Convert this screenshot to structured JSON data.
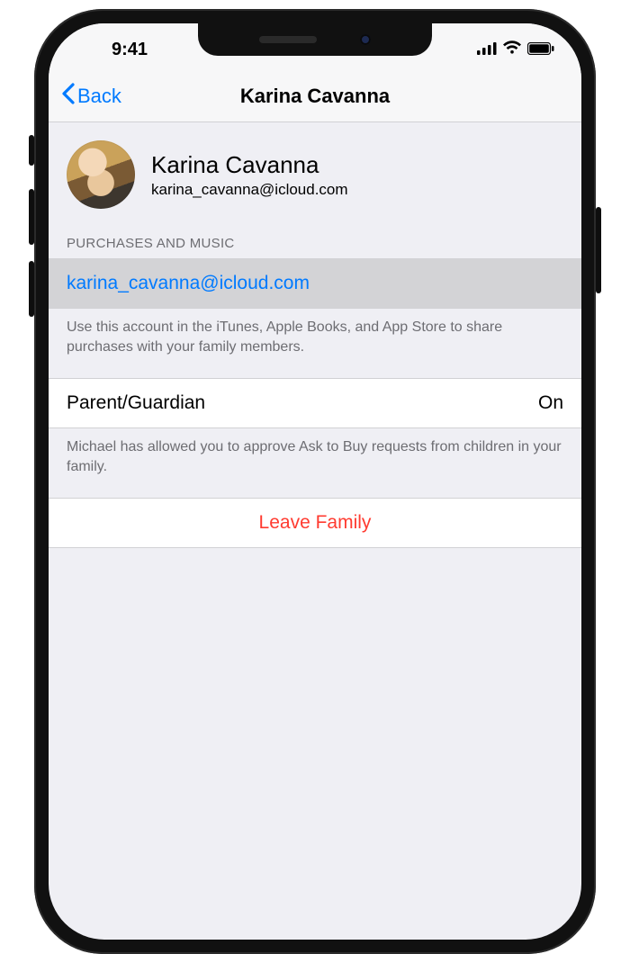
{
  "statusbar": {
    "time": "9:41"
  },
  "nav": {
    "back_label": "Back",
    "title": "Karina Cavanna"
  },
  "profile": {
    "name": "Karina Cavanna",
    "email": "karina_cavanna@icloud.com"
  },
  "purchases": {
    "section_title": "PURCHASES AND MUSIC",
    "account_email": "karina_cavanna@icloud.com",
    "note": "Use this account in the iTunes, Apple Books, and App Store to share purchases with your family members."
  },
  "guardian": {
    "label": "Parent/Guardian",
    "value": "On",
    "note": "Michael has allowed you to approve Ask to Buy requests from children in your family."
  },
  "leave": {
    "label": "Leave Family"
  }
}
